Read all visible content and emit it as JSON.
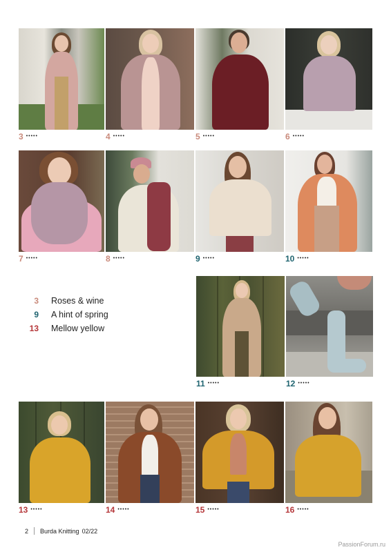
{
  "colors": {
    "pink": "#c98a7b",
    "teal": "#1f6470",
    "red": "#b5373a"
  },
  "captions": [
    {
      "num": "3",
      "color": "#c98a7b",
      "dots": "•••••"
    },
    {
      "num": "4",
      "color": "#c98a7b",
      "dots": "•••••"
    },
    {
      "num": "5",
      "color": "#c98a7b",
      "dots": "•••••"
    },
    {
      "num": "6",
      "color": "#c98a7b",
      "dots": "•••••"
    },
    {
      "num": "7",
      "color": "#c98a7b",
      "dots": "•••••"
    },
    {
      "num": "8",
      "color": "#c98a7b",
      "dots": "•••••"
    },
    {
      "num": "9",
      "color": "#1f6470",
      "dots": "•••••"
    },
    {
      "num": "10",
      "color": "#1f6470",
      "dots": "•••••"
    },
    {
      "num": "11",
      "color": "#1f6470",
      "dots": "•••••"
    },
    {
      "num": "12",
      "color": "#1f6470",
      "dots": "•••••"
    },
    {
      "num": "13",
      "color": "#b5373a",
      "dots": "•••••"
    },
    {
      "num": "14",
      "color": "#b5373a",
      "dots": "•••••"
    },
    {
      "num": "15",
      "color": "#b5373a",
      "dots": "•••••"
    },
    {
      "num": "16",
      "color": "#b5373a",
      "dots": "•••••"
    }
  ],
  "legend": [
    {
      "num": "3",
      "label": "Roses & wine",
      "color": "#c98a7b"
    },
    {
      "num": "9",
      "label": "A hint of spring",
      "color": "#1f6470"
    },
    {
      "num": "13",
      "label": "Mellow yellow",
      "color": "#b5373a"
    }
  ],
  "footer": {
    "page": "2",
    "magazine": "Burda Knitting",
    "issue": "02/22"
  },
  "watermark": "PassionForum.ru"
}
